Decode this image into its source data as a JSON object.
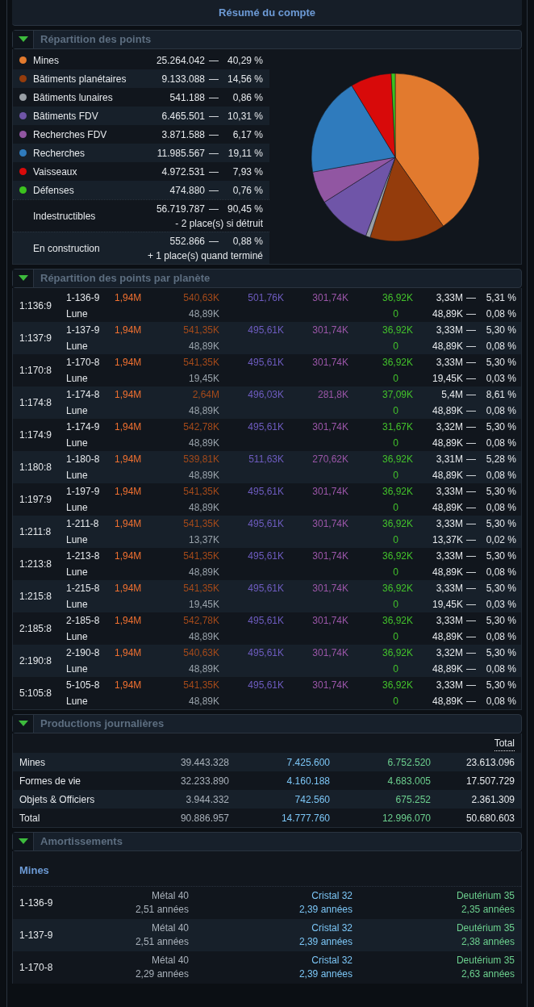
{
  "window": {
    "title": "Résumé du compte"
  },
  "points_section": {
    "title": "Répartition des points",
    "expanded": true,
    "categories": [
      {
        "label": "Mines",
        "color": "#e27a2e",
        "points": "25.264.042",
        "separator": "—",
        "percent": "40,29 %"
      },
      {
        "label": "Bâtiments planétaires",
        "color": "#943c0c",
        "points": "9.133.088",
        "separator": "—",
        "percent": "14,56 %"
      },
      {
        "label": "Bâtiments lunaires",
        "color": "#9aa0a6",
        "points": "541.188",
        "separator": "—",
        "percent": "0,86 %"
      },
      {
        "label": "Bâtiments FDV",
        "color": "#6f55a8",
        "points": "6.465.501",
        "separator": "—",
        "percent": "10,31 %"
      },
      {
        "label": "Recherches FDV",
        "color": "#9156a2",
        "points": "3.871.588",
        "separator": "—",
        "percent": "6,17 %"
      },
      {
        "label": "Recherches",
        "color": "#2f7bbd",
        "points": "11.985.567",
        "separator": "—",
        "percent": "19,11 %"
      },
      {
        "label": "Vaisseaux",
        "color": "#d80a0a",
        "points": "4.972.531",
        "separator": "—",
        "percent": "7,93 %"
      },
      {
        "label": "Défenses",
        "color": "#3cc21e",
        "points": "474.880",
        "separator": "—",
        "percent": "0,76 %"
      }
    ],
    "summary": [
      {
        "label": "Indestructibles",
        "points": "56.719.787",
        "separator": "—",
        "percent": "90,45 %",
        "note": "- 2 place(s) si détruit"
      },
      {
        "label": "En construction",
        "points": "552.866",
        "separator": "—",
        "percent": "0,88 %",
        "note": "+ 1 place(s) quand terminé"
      }
    ],
    "chart_data": {
      "type": "pie",
      "values": [
        40.29,
        14.56,
        0.86,
        10.31,
        6.17,
        19.11,
        7.93,
        0.76
      ]
    }
  },
  "planets_section": {
    "title": "Répartition des points par planète",
    "expanded": true,
    "planets": [
      {
        "coords": "1:136:9",
        "name": "1-136-9",
        "mines": "1,94M",
        "buildings": "540,63K",
        "lf_buildings": "501,76K",
        "lf_research": "301,74K",
        "defenses": "36,92K",
        "total": "3,33M",
        "separator": "—",
        "percent": "5,31 %",
        "moon": {
          "name": "Lune",
          "buildings": "48,89K",
          "defenses": "0",
          "total": "48,89K",
          "separator": "—",
          "percent": "0,08 %"
        }
      },
      {
        "coords": "1:137:9",
        "name": "1-137-9",
        "mines": "1,94M",
        "buildings": "541,35K",
        "lf_buildings": "495,61K",
        "lf_research": "301,74K",
        "defenses": "36,92K",
        "total": "3,33M",
        "separator": "—",
        "percent": "5,30 %",
        "moon": {
          "name": "Lune",
          "buildings": "48,89K",
          "defenses": "0",
          "total": "48,89K",
          "separator": "—",
          "percent": "0,08 %"
        }
      },
      {
        "coords": "1:170:8",
        "name": "1-170-8",
        "mines": "1,94M",
        "buildings": "541,35K",
        "lf_buildings": "495,61K",
        "lf_research": "301,74K",
        "defenses": "36,92K",
        "total": "3,33M",
        "separator": "—",
        "percent": "5,30 %",
        "moon": {
          "name": "Lune",
          "buildings": "19,45K",
          "defenses": "0",
          "total": "19,45K",
          "separator": "—",
          "percent": "0,03 %"
        }
      },
      {
        "coords": "1:174:8",
        "name": "1-174-8",
        "mines": "1,94M",
        "buildings": "2,64M",
        "lf_buildings": "496,03K",
        "lf_research": "281,8K",
        "defenses": "37,09K",
        "total": "5,4M",
        "separator": "—",
        "percent": "8,61 %",
        "moon": {
          "name": "Lune",
          "buildings": "48,89K",
          "defenses": "0",
          "total": "48,89K",
          "separator": "—",
          "percent": "0,08 %"
        }
      },
      {
        "coords": "1:174:9",
        "name": "1-174-9",
        "mines": "1,94M",
        "buildings": "542,78K",
        "lf_buildings": "495,61K",
        "lf_research": "301,74K",
        "defenses": "31,67K",
        "total": "3,32M",
        "separator": "—",
        "percent": "5,30 %",
        "moon": {
          "name": "Lune",
          "buildings": "48,89K",
          "defenses": "0",
          "total": "48,89K",
          "separator": "—",
          "percent": "0,08 %"
        }
      },
      {
        "coords": "1:180:8",
        "name": "1-180-8",
        "mines": "1,94M",
        "buildings": "539,81K",
        "lf_buildings": "511,63K",
        "lf_research": "270,62K",
        "defenses": "36,92K",
        "total": "3,31M",
        "separator": "—",
        "percent": "5,28 %",
        "moon": {
          "name": "Lune",
          "buildings": "48,89K",
          "defenses": "0",
          "total": "48,89K",
          "separator": "—",
          "percent": "0,08 %"
        }
      },
      {
        "coords": "1:197:9",
        "name": "1-197-9",
        "mines": "1,94M",
        "buildings": "541,35K",
        "lf_buildings": "495,61K",
        "lf_research": "301,74K",
        "defenses": "36,92K",
        "total": "3,33M",
        "separator": "—",
        "percent": "5,30 %",
        "moon": {
          "name": "Lune",
          "buildings": "48,89K",
          "defenses": "0",
          "total": "48,89K",
          "separator": "—",
          "percent": "0,08 %"
        }
      },
      {
        "coords": "1:211:8",
        "name": "1-211-8",
        "mines": "1,94M",
        "buildings": "541,35K",
        "lf_buildings": "495,61K",
        "lf_research": "301,74K",
        "defenses": "36,92K",
        "total": "3,33M",
        "separator": "—",
        "percent": "5,30 %",
        "moon": {
          "name": "Lune",
          "buildings": "13,37K",
          "defenses": "0",
          "total": "13,37K",
          "separator": "—",
          "percent": "0,02 %"
        }
      },
      {
        "coords": "1:213:8",
        "name": "1-213-8",
        "mines": "1,94M",
        "buildings": "541,35K",
        "lf_buildings": "495,61K",
        "lf_research": "301,74K",
        "defenses": "36,92K",
        "total": "3,33M",
        "separator": "—",
        "percent": "5,30 %",
        "moon": {
          "name": "Lune",
          "buildings": "48,89K",
          "defenses": "0",
          "total": "48,89K",
          "separator": "—",
          "percent": "0,08 %"
        }
      },
      {
        "coords": "1:215:8",
        "name": "1-215-8",
        "mines": "1,94M",
        "buildings": "541,35K",
        "lf_buildings": "495,61K",
        "lf_research": "301,74K",
        "defenses": "36,92K",
        "total": "3,33M",
        "separator": "—",
        "percent": "5,30 %",
        "moon": {
          "name": "Lune",
          "buildings": "19,45K",
          "defenses": "0",
          "total": "19,45K",
          "separator": "—",
          "percent": "0,03 %"
        }
      },
      {
        "coords": "2:185:8",
        "name": "2-185-8",
        "mines": "1,94M",
        "buildings": "542,78K",
        "lf_buildings": "495,61K",
        "lf_research": "301,74K",
        "defenses": "36,92K",
        "total": "3,33M",
        "separator": "—",
        "percent": "5,30 %",
        "moon": {
          "name": "Lune",
          "buildings": "48,89K",
          "defenses": "0",
          "total": "48,89K",
          "separator": "—",
          "percent": "0,08 %"
        }
      },
      {
        "coords": "2:190:8",
        "name": "2-190-8",
        "mines": "1,94M",
        "buildings": "540,63K",
        "lf_buildings": "495,61K",
        "lf_research": "301,74K",
        "defenses": "36,92K",
        "total": "3,32M",
        "separator": "—",
        "percent": "5,30 %",
        "moon": {
          "name": "Lune",
          "buildings": "48,89K",
          "defenses": "0",
          "total": "48,89K",
          "separator": "—",
          "percent": "0,08 %"
        }
      },
      {
        "coords": "5:105:8",
        "name": "5-105-8",
        "mines": "1,94M",
        "buildings": "541,35K",
        "lf_buildings": "495,61K",
        "lf_research": "301,74K",
        "defenses": "36,92K",
        "total": "3,33M",
        "separator": "—",
        "percent": "5,30 %",
        "moon": {
          "name": "Lune",
          "buildings": "48,89K",
          "defenses": "0",
          "total": "48,89K",
          "separator": "—",
          "percent": "0,08 %"
        }
      }
    ]
  },
  "production_section": {
    "title": "Productions journalières",
    "expanded": true,
    "total_heading": "Total",
    "rows": [
      {
        "label": "Mines",
        "metal": "39.443.328",
        "crystal": "7.425.600",
        "deuterium": "6.752.520",
        "total": "23.613.096"
      },
      {
        "label": "Formes de vie",
        "metal": "32.233.890",
        "crystal": "4.160.188",
        "deuterium": "4.683.005",
        "total": "17.507.729"
      },
      {
        "label": "Objets & Officiers",
        "metal": "3.944.332",
        "crystal": "742.560",
        "deuterium": "675.252",
        "total": "2.361.309"
      },
      {
        "label": "Total",
        "metal": "90.886.957",
        "crystal": "14.777.760",
        "deuterium": "12.996.070",
        "total": "50.680.603"
      }
    ]
  },
  "amortization_section": {
    "title": "Amortissements",
    "expanded": true,
    "group_title": "Mines",
    "rows": [
      {
        "planet": "1-136-9",
        "metal": {
          "label": "Métal 40",
          "time": "2,51 années"
        },
        "crystal": {
          "label": "Cristal 32",
          "time": "2,39 années"
        },
        "deuterium": {
          "label": "Deutérium 35",
          "time": "2,35 années"
        }
      },
      {
        "planet": "1-137-9",
        "metal": {
          "label": "Métal 40",
          "time": "2,51 années"
        },
        "crystal": {
          "label": "Cristal 32",
          "time": "2,39 années"
        },
        "deuterium": {
          "label": "Deutérium 35",
          "time": "2,38 années"
        }
      },
      {
        "planet": "1-170-8",
        "metal": {
          "label": "Métal 40",
          "time": "2,29 années"
        },
        "crystal": {
          "label": "Cristal 32",
          "time": "2,39 années"
        },
        "deuterium": {
          "label": "Deutérium 35",
          "time": "2,63 années"
        }
      }
    ]
  }
}
